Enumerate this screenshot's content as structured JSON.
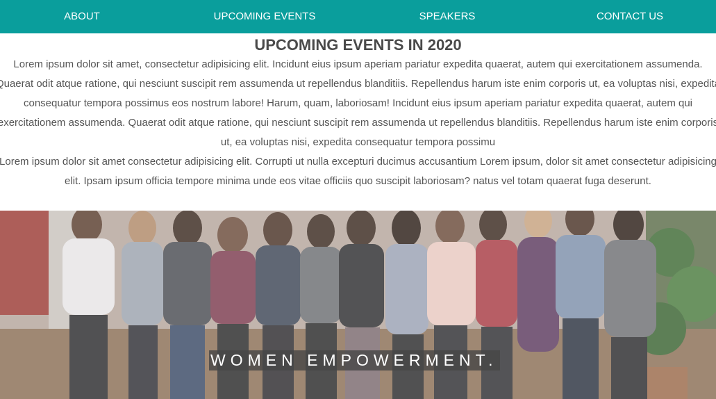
{
  "nav": {
    "items": [
      {
        "label": "ABOUT"
      },
      {
        "label": "UPCOMING EVENTS"
      },
      {
        "label": "SPEAKERS"
      },
      {
        "label": "CONTACT US"
      }
    ],
    "background_color": "#0a9e9c"
  },
  "events": {
    "title": "UPCOMING EVENTS IN 2020",
    "paragraph1": "Lorem ipsum dolor sit amet, consectetur adipisicing elit. Incidunt eius ipsum aperiam pariatur expedita quaerat, autem qui exercitationem assumenda. Quaerat odit atque ratione, qui nesciunt suscipit rem assumenda ut repellendus blanditiis. Repellendus harum iste enim corporis ut, ea voluptas nisi, expedita consequatur tempora possimus eos nostrum labore! Harum, quam, laboriosam! Incidunt eius ipsum aperiam pariatur expedita quaerat, autem qui exercitationem assumenda. Quaerat odit atque ratione, qui nesciunt suscipit rem assumenda ut repellendus blanditiis. Repellendus harum iste enim corporis ut, ea voluptas nisi, expedita consequatur tempora possimu",
    "paragraph2": "Lorem ipsum dolor sit amet consectetur adipisicing elit. Corrupti ut nulla excepturi ducimus accusantium Lorem ipsum, dolor sit amet consectetur adipisicing elit. Ipsam ipsum officia tempore minima unde eos vitae officiis quo suscipit laboriosam? natus vel totam quaerat fuga deserunt."
  },
  "hero": {
    "caption": "WOMEN EMPOWERMENT."
  }
}
